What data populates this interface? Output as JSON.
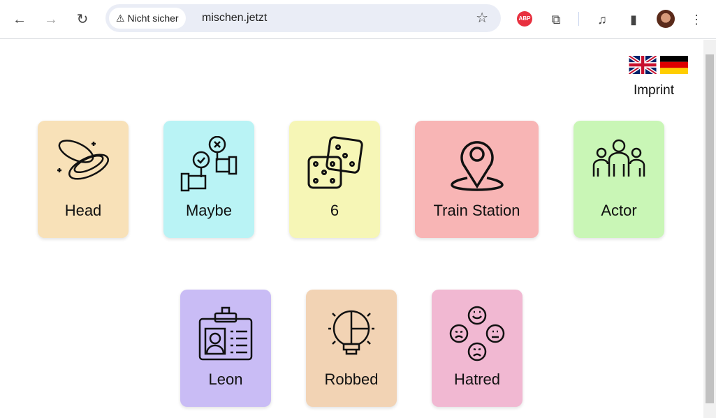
{
  "browser": {
    "security_label": "Nicht sicher",
    "url": "mischen.jetzt",
    "extension_abp": "ABP"
  },
  "page": {
    "imprint": "Imprint",
    "languages": [
      "English",
      "Deutsch"
    ]
  },
  "cards": [
    {
      "label": "Head",
      "icon": "coins-icon",
      "color": "#f8e1b8"
    },
    {
      "label": "Maybe",
      "icon": "vote-hands-icon",
      "color": "#b9f3f5"
    },
    {
      "label": "6",
      "icon": "dice-icon",
      "color": "#f6f6b6"
    },
    {
      "label": "Train Station",
      "icon": "location-pin-icon",
      "color": "#f8b5b5"
    },
    {
      "label": "Actor",
      "icon": "group-people-icon",
      "color": "#c9f6b6"
    },
    {
      "label": "Leon",
      "icon": "id-badge-icon",
      "color": "#c9bcf5"
    },
    {
      "label": "Robbed",
      "icon": "puzzle-bulb-icon",
      "color": "#f2d3b4"
    },
    {
      "label": "Hatred",
      "icon": "emotions-icon",
      "color": "#f1b8d2"
    }
  ]
}
